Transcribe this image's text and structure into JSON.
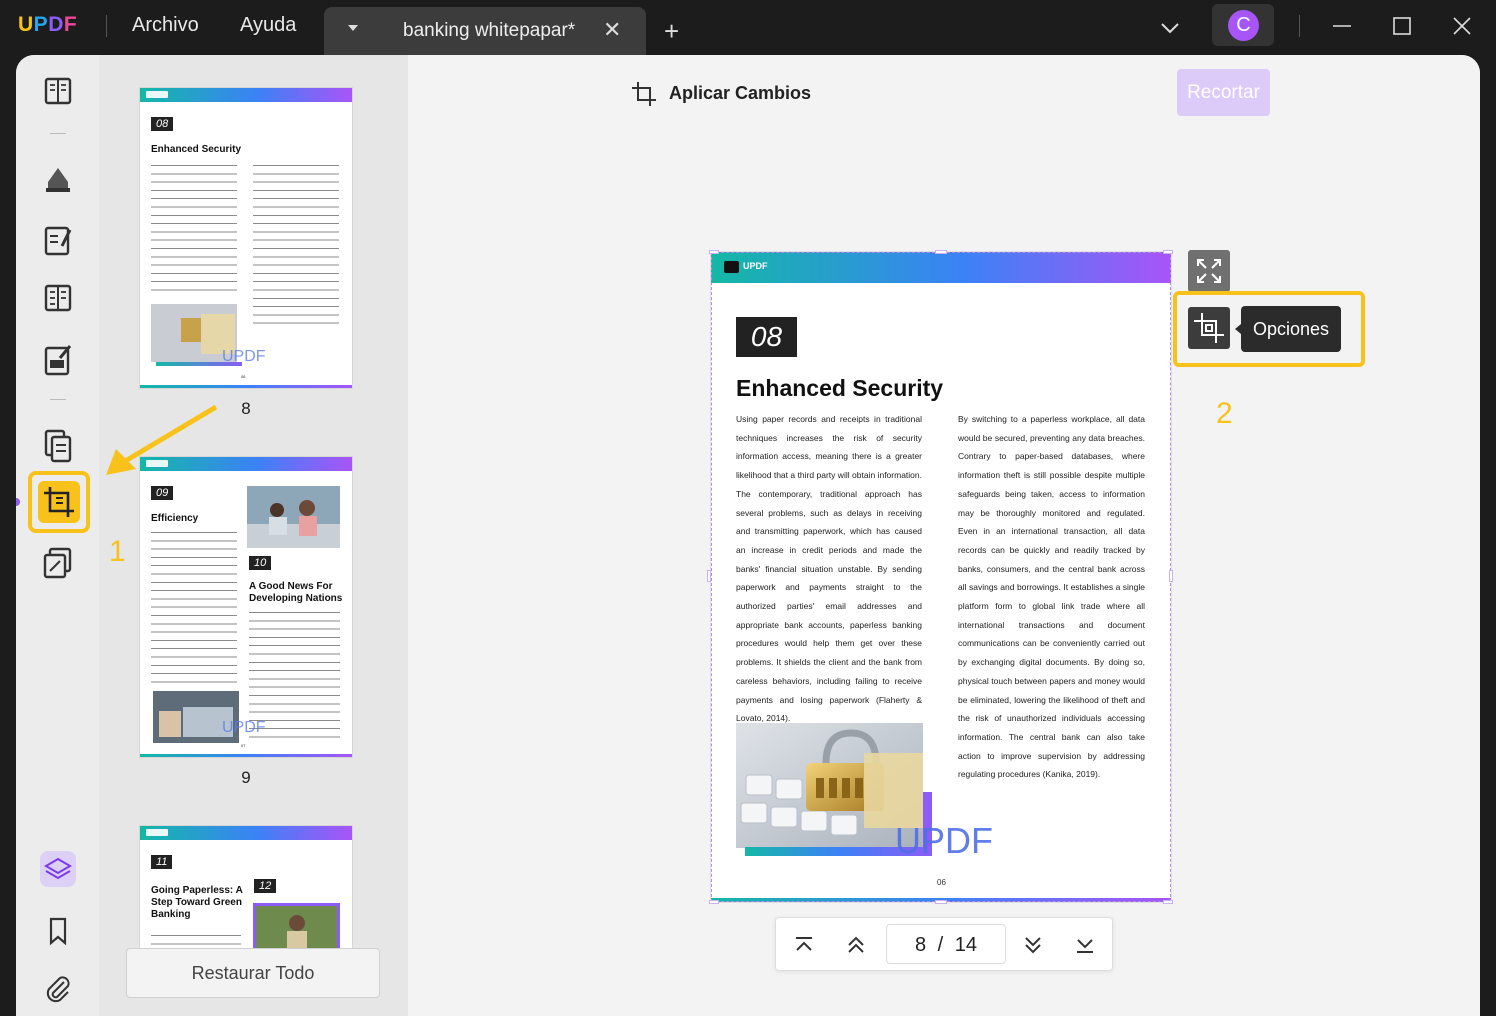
{
  "app": {
    "logo": "UPDF",
    "menu": [
      "Archivo",
      "Ayuda"
    ],
    "tab_title": "banking whitepapar*",
    "avatar_initial": "C",
    "brand_colors": {
      "yellow": "#f8c21a",
      "purple": "#8b5cf6",
      "blue": "#3b82f6"
    }
  },
  "toolbar": {
    "apply_label": "Aplicar Cambios",
    "crop_button": "Recortar",
    "options_tooltip": "Opciones"
  },
  "thumbnails": {
    "restore_button": "Restaurar Todo",
    "pages": [
      {
        "label": "8",
        "num": "08",
        "title": "Enhanced Security",
        "watermark": "UPDF",
        "page_no": "06"
      },
      {
        "label": "9",
        "num": "09",
        "title": "Efficiency",
        "num2": "10",
        "title2": "A Good News For Developing Nations",
        "watermark": "UPDF",
        "page_no": "07"
      },
      {
        "num": "11",
        "title": "Going Paperless: A Step Toward Green Banking",
        "num2": "12"
      }
    ]
  },
  "document": {
    "header_logo": "UPDF",
    "section_number": "08",
    "title": "Enhanced Security",
    "col_left": "Using paper records and receipts in traditional techniques increases the risk of security information access, meaning there is a greater likelihood that a third party will obtain information. The contemporary, traditional approach has several problems, such as delays in receiving and transmitting paperwork, which has caused an increase in credit periods and made the banks' financial situation unstable. By sending paperwork and payments straight to the authorized parties' email addresses and appropriate bank accounts, paperless banking procedures would help them get over these problems. It shields the client and the bank from careless behaviors, including failing to receive payments and losing paperwork (Flaherty & Lovato, 2014).",
    "col_right": "By switching to a paperless workplace, all data would be secured, preventing any data breaches. Contrary to paper-based databases, where information theft is still possible despite multiple safeguards being taken, access to information may be thoroughly monitored and regulated. Even in an international transaction, all data records can be quickly and readily tracked by banks, consumers, and the central bank across all savings and borrowings. It establishes a single platform form to global link trade where all international transactions and document communications can be conveniently carried out by exchanging digital documents. By doing so, physical touch between papers and money would be eliminated, lowering the likelihood of theft and the risk of unauthorized individuals accessing information. The central bank can also take action to improve supervision by addressing regulating procedures (Kanika, 2019).",
    "watermark": "UPDF",
    "page_footer": "06"
  },
  "pager": {
    "current": "8",
    "separator": "/",
    "total": "14"
  },
  "annotations": {
    "step1": "1",
    "step2": "2"
  }
}
